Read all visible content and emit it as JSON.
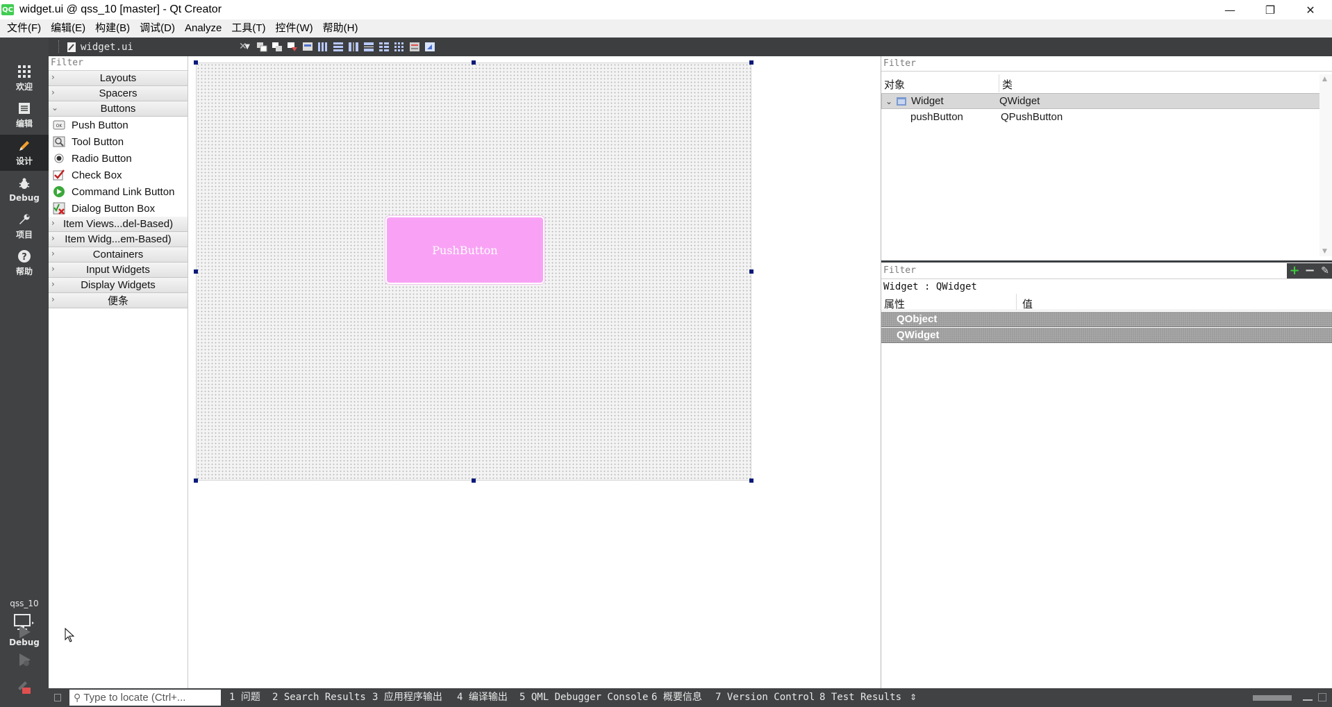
{
  "window": {
    "title": "widget.ui @ qss_10 [master] - Qt Creator",
    "app_icon_text": "QC"
  },
  "menubar": [
    "文件(F)",
    "编辑(E)",
    "构建(B)",
    "调试(D)",
    "Analyze",
    "工具(T)",
    "控件(W)",
    "帮助(H)"
  ],
  "modes": [
    "欢迎",
    "编辑",
    "设计",
    "Debug",
    "项目",
    "帮助"
  ],
  "active_mode": "设计",
  "kit": {
    "project": "qss_10",
    "build": "Debug"
  },
  "form_toolbar": {
    "document": "widget.ui"
  },
  "widget_box": {
    "filter_placeholder": "Filter",
    "cat_layouts": "Layouts",
    "cat_spacers": "Spacers",
    "cat_buttons": "Buttons",
    "buttons": [
      "Push Button",
      "Tool Button",
      "Radio Button",
      "Check Box",
      "Command Link Button",
      "Dialog Button Box"
    ],
    "cat_item_views": "Item Views...del-Based)",
    "cat_item_widgets": "Item Widg...em-Based)",
    "cat_containers": "Containers",
    "cat_input": "Input Widgets",
    "cat_display": "Display Widgets",
    "cat_misc": "便条"
  },
  "canvas": {
    "push_button_text": "PushButton",
    "push_button_color": "#f9a2f5"
  },
  "object_inspector": {
    "filter_placeholder": "Filter",
    "col_object": "对象",
    "col_class": "类",
    "rows": [
      {
        "object": "Widget",
        "class": "QWidget"
      },
      {
        "object": "pushButton",
        "class": "QPushButton"
      }
    ]
  },
  "property_editor": {
    "filter_placeholder": "Filter",
    "current": "Widget : QWidget",
    "col_property": "属性",
    "col_value": "值",
    "groups": [
      "QObject",
      "QWidget"
    ]
  },
  "statusbar": {
    "locator_placeholder": "Type to locate (Ctrl+...",
    "panes": [
      "1 问题",
      "2 Search Results",
      "3 应用程序输出",
      "4 编译输出",
      "5 QML Debugger Console",
      "6 概要信息",
      "7 Version Control",
      "8 Test Results"
    ]
  }
}
